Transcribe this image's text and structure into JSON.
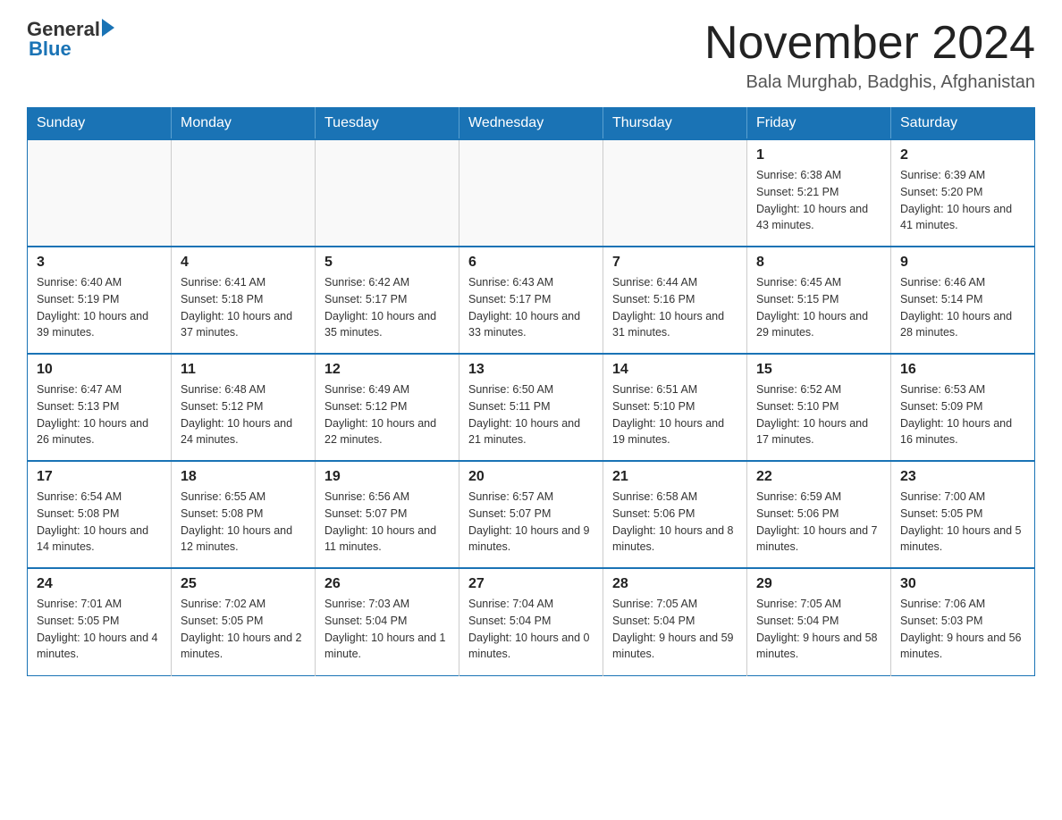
{
  "logo": {
    "general_text": "General",
    "blue_text": "Blue"
  },
  "title": "November 2024",
  "subtitle": "Bala Murghab, Badghis, Afghanistan",
  "days_of_week": [
    "Sunday",
    "Monday",
    "Tuesday",
    "Wednesday",
    "Thursday",
    "Friday",
    "Saturday"
  ],
  "weeks": [
    [
      {
        "day": "",
        "info": ""
      },
      {
        "day": "",
        "info": ""
      },
      {
        "day": "",
        "info": ""
      },
      {
        "day": "",
        "info": ""
      },
      {
        "day": "",
        "info": ""
      },
      {
        "day": "1",
        "info": "Sunrise: 6:38 AM\nSunset: 5:21 PM\nDaylight: 10 hours and 43 minutes."
      },
      {
        "day": "2",
        "info": "Sunrise: 6:39 AM\nSunset: 5:20 PM\nDaylight: 10 hours and 41 minutes."
      }
    ],
    [
      {
        "day": "3",
        "info": "Sunrise: 6:40 AM\nSunset: 5:19 PM\nDaylight: 10 hours and 39 minutes."
      },
      {
        "day": "4",
        "info": "Sunrise: 6:41 AM\nSunset: 5:18 PM\nDaylight: 10 hours and 37 minutes."
      },
      {
        "day": "5",
        "info": "Sunrise: 6:42 AM\nSunset: 5:17 PM\nDaylight: 10 hours and 35 minutes."
      },
      {
        "day": "6",
        "info": "Sunrise: 6:43 AM\nSunset: 5:17 PM\nDaylight: 10 hours and 33 minutes."
      },
      {
        "day": "7",
        "info": "Sunrise: 6:44 AM\nSunset: 5:16 PM\nDaylight: 10 hours and 31 minutes."
      },
      {
        "day": "8",
        "info": "Sunrise: 6:45 AM\nSunset: 5:15 PM\nDaylight: 10 hours and 29 minutes."
      },
      {
        "day": "9",
        "info": "Sunrise: 6:46 AM\nSunset: 5:14 PM\nDaylight: 10 hours and 28 minutes."
      }
    ],
    [
      {
        "day": "10",
        "info": "Sunrise: 6:47 AM\nSunset: 5:13 PM\nDaylight: 10 hours and 26 minutes."
      },
      {
        "day": "11",
        "info": "Sunrise: 6:48 AM\nSunset: 5:12 PM\nDaylight: 10 hours and 24 minutes."
      },
      {
        "day": "12",
        "info": "Sunrise: 6:49 AM\nSunset: 5:12 PM\nDaylight: 10 hours and 22 minutes."
      },
      {
        "day": "13",
        "info": "Sunrise: 6:50 AM\nSunset: 5:11 PM\nDaylight: 10 hours and 21 minutes."
      },
      {
        "day": "14",
        "info": "Sunrise: 6:51 AM\nSunset: 5:10 PM\nDaylight: 10 hours and 19 minutes."
      },
      {
        "day": "15",
        "info": "Sunrise: 6:52 AM\nSunset: 5:10 PM\nDaylight: 10 hours and 17 minutes."
      },
      {
        "day": "16",
        "info": "Sunrise: 6:53 AM\nSunset: 5:09 PM\nDaylight: 10 hours and 16 minutes."
      }
    ],
    [
      {
        "day": "17",
        "info": "Sunrise: 6:54 AM\nSunset: 5:08 PM\nDaylight: 10 hours and 14 minutes."
      },
      {
        "day": "18",
        "info": "Sunrise: 6:55 AM\nSunset: 5:08 PM\nDaylight: 10 hours and 12 minutes."
      },
      {
        "day": "19",
        "info": "Sunrise: 6:56 AM\nSunset: 5:07 PM\nDaylight: 10 hours and 11 minutes."
      },
      {
        "day": "20",
        "info": "Sunrise: 6:57 AM\nSunset: 5:07 PM\nDaylight: 10 hours and 9 minutes."
      },
      {
        "day": "21",
        "info": "Sunrise: 6:58 AM\nSunset: 5:06 PM\nDaylight: 10 hours and 8 minutes."
      },
      {
        "day": "22",
        "info": "Sunrise: 6:59 AM\nSunset: 5:06 PM\nDaylight: 10 hours and 7 minutes."
      },
      {
        "day": "23",
        "info": "Sunrise: 7:00 AM\nSunset: 5:05 PM\nDaylight: 10 hours and 5 minutes."
      }
    ],
    [
      {
        "day": "24",
        "info": "Sunrise: 7:01 AM\nSunset: 5:05 PM\nDaylight: 10 hours and 4 minutes."
      },
      {
        "day": "25",
        "info": "Sunrise: 7:02 AM\nSunset: 5:05 PM\nDaylight: 10 hours and 2 minutes."
      },
      {
        "day": "26",
        "info": "Sunrise: 7:03 AM\nSunset: 5:04 PM\nDaylight: 10 hours and 1 minute."
      },
      {
        "day": "27",
        "info": "Sunrise: 7:04 AM\nSunset: 5:04 PM\nDaylight: 10 hours and 0 minutes."
      },
      {
        "day": "28",
        "info": "Sunrise: 7:05 AM\nSunset: 5:04 PM\nDaylight: 9 hours and 59 minutes."
      },
      {
        "day": "29",
        "info": "Sunrise: 7:05 AM\nSunset: 5:04 PM\nDaylight: 9 hours and 58 minutes."
      },
      {
        "day": "30",
        "info": "Sunrise: 7:06 AM\nSunset: 5:03 PM\nDaylight: 9 hours and 56 minutes."
      }
    ]
  ]
}
